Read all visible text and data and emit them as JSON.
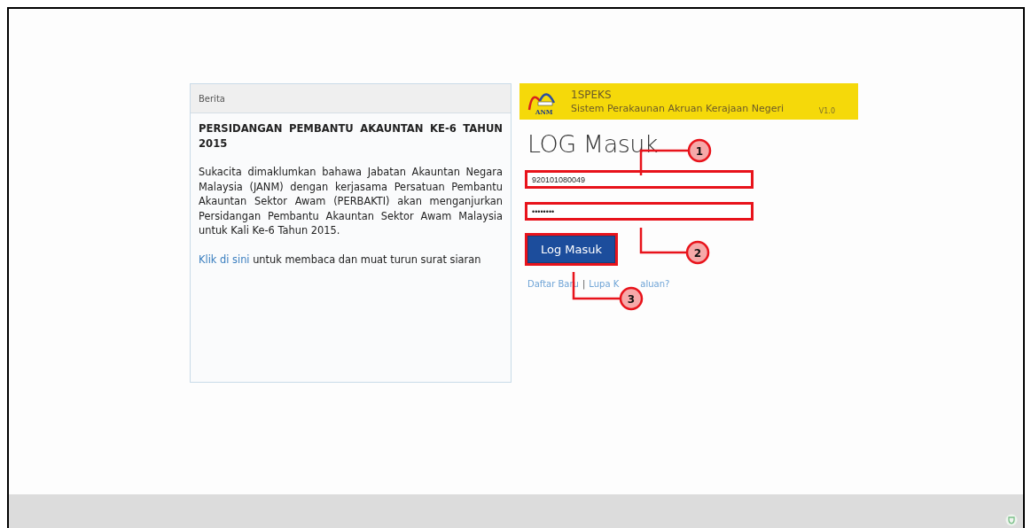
{
  "news": {
    "header": "Berita",
    "title": "PERSIDANGAN PEMBANTU AKAUNTAN KE-6 TAHUN 2015",
    "body": "Sukacita dimaklumkan bahawa Jabatan Akauntan Negara Malaysia (JANM) dengan kerjasama Persatuan Pembantu Akauntan Sektor Awam (PERBAKTI) akan menganjurkan Persidangan Pembantu Akauntan Sektor Awam Malaysia untuk Kali Ke-6 Tahun 2015.",
    "link": "Klik di sini",
    "link_after": "untuk membaca dan muat turun surat siaran"
  },
  "banner": {
    "logo_text": "ANM",
    "app_name": "1SPEKS",
    "subtitle": "Sistem Perakaunan Akruan Kerajaan Negeri",
    "version": "V1.0"
  },
  "login": {
    "title": "LOG Masuk",
    "username": "920101080049",
    "password": "••••••••",
    "button": "Log Masuk",
    "register_link": "Daftar Baru",
    "separator": "|",
    "forgot_link_start": "Lupa K",
    "forgot_link_end": "aluan?"
  },
  "callouts": [
    {
      "number": "1"
    },
    {
      "number": "2"
    },
    {
      "number": "3"
    }
  ]
}
